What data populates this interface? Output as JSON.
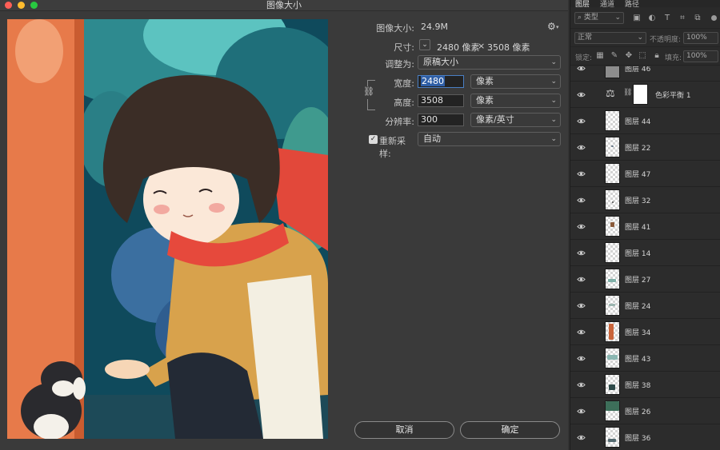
{
  "window": {
    "title": "图像大小"
  },
  "dialog": {
    "image_size": {
      "label": "图像大小:",
      "value": "24.9M"
    },
    "dimensions": {
      "label": "尺寸:",
      "width": "2480 像素",
      "times": "×",
      "height": "3508 像素"
    },
    "fit_to": {
      "label": "调整为:",
      "value": "原稿大小"
    },
    "width": {
      "label": "宽度:",
      "value": "2480",
      "unit": "像素"
    },
    "height": {
      "label": "高度:",
      "value": "3508",
      "unit": "像素"
    },
    "resolution": {
      "label": "分辨率:",
      "value": "300",
      "unit": "像素/英寸"
    },
    "resample": {
      "label": "重新采样:",
      "checked": true,
      "value": "自动"
    },
    "buttons": {
      "cancel": "取消",
      "ok": "确定"
    }
  },
  "layers_panel": {
    "tabs": [
      "图层",
      "通道",
      "路径"
    ],
    "filter_kind": "类型",
    "blend_mode": "正常",
    "opacity": {
      "label": "不透明度:",
      "value": "100%"
    },
    "lock_label": "锁定:",
    "fill": {
      "label": "填充:",
      "value": "100%"
    },
    "layers": [
      {
        "name": "图层 46",
        "type": "pixel"
      },
      {
        "name": "色彩平衡 1",
        "type": "adjustment"
      },
      {
        "name": "图层 44",
        "type": "pixel"
      },
      {
        "name": "图层 22",
        "type": "pixel"
      },
      {
        "name": "图层 47",
        "type": "pixel"
      },
      {
        "name": "图层 32",
        "type": "pixel"
      },
      {
        "name": "图层 41",
        "type": "pixel"
      },
      {
        "name": "图层 14",
        "type": "pixel"
      },
      {
        "name": "图层 27",
        "type": "pixel"
      },
      {
        "name": "图层 24",
        "type": "pixel"
      },
      {
        "name": "图层 34",
        "type": "pixel"
      },
      {
        "name": "图层 43",
        "type": "pixel"
      },
      {
        "name": "图层 38",
        "type": "pixel"
      },
      {
        "name": "图层 26",
        "type": "pixel"
      },
      {
        "name": "图层 36",
        "type": "pixel"
      }
    ]
  },
  "icons": {
    "traffic_lights": [
      "close-icon",
      "minimize-icon",
      "zoom-icon"
    ],
    "settings": "gear-icon",
    "constrain": "chain-link-icon",
    "visibility": "eye-icon"
  },
  "colors": {
    "dialog_bg": "#3a3a3a",
    "panel_bg": "#2a2a2a",
    "selection": "#2f5fa7",
    "close": "#ff5f57",
    "minimize": "#febc2e",
    "zoom": "#28c840"
  }
}
